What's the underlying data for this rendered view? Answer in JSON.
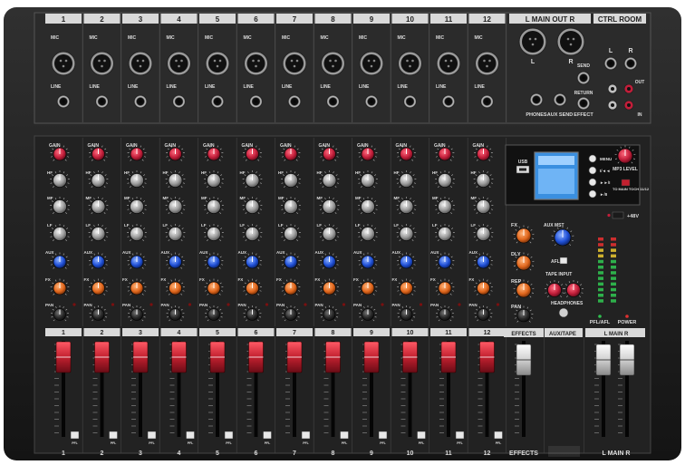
{
  "channels": [
    "1",
    "2",
    "3",
    "4",
    "5",
    "6",
    "7",
    "8",
    "9",
    "10",
    "11",
    "12"
  ],
  "input_labels": {
    "mic": "MIC",
    "line": "LINE"
  },
  "eq_labels": [
    "GAIN",
    "HF",
    "MF",
    "LF"
  ],
  "send_labels": [
    "AUX",
    "FX",
    "PAN"
  ],
  "main_out": {
    "title": "L MAIN OUT R",
    "left": "L",
    "right": "R"
  },
  "ctrl_room": {
    "title": "CTRL ROOM",
    "left": "L",
    "right": "R"
  },
  "patch": {
    "phones": "PHONES",
    "aux_send": "AUX SEND",
    "effect": "EFFECT",
    "send": "SEND",
    "return": "RETURN",
    "tape_in": "IN",
    "tape_out": "OUT"
  },
  "player": {
    "usb": "USB",
    "buttons": [
      "MENU",
      "I/◄◄",
      "►►/I",
      "►/II"
    ],
    "mp3_level": "MP3 LEVEL",
    "bt": "TO MAIN TOCH 11/12"
  },
  "master_section": {
    "fx": "FX",
    "dly": "DLY",
    "rep": "REP",
    "pan": "PAN",
    "aux_mst": "AUX MST",
    "afl": "AFL",
    "tape_input": "TAPE INPUT",
    "headphones": "HEADPHONES",
    "phantom": "+48V",
    "pfl_afl": "PFL/AFL",
    "power": "POWER"
  },
  "fader_labels": {
    "effects": "EFFECTS",
    "aux_tape": "AUX/TAPE",
    "main": "L MAIN R",
    "pfl": "PFL"
  },
  "colors": {
    "body": "#1b1b1b",
    "panel": "#262626",
    "gain_knob": "#c21e3a",
    "aux_knob": "#1f4fd6",
    "fx_knob": "#e0661c",
    "fader_cap": "#c2202f",
    "lcd": "#3a8fe0"
  }
}
